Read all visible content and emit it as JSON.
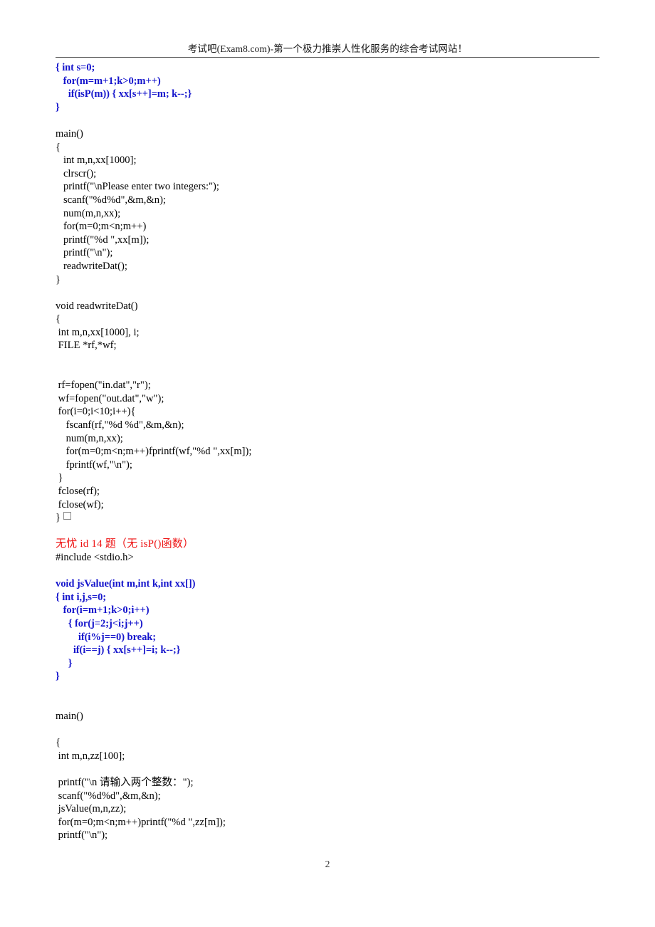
{
  "document": {
    "page_number": "2",
    "header_text": "考试吧(Exam8.com)-第一个极力推崇人性化服务的综合考试网站！",
    "colors": {
      "code_blue": "#1515CC",
      "heading_red": "#EE1111",
      "body_black": "#000000",
      "rule_gray": "#555555"
    }
  },
  "lines": [
    {
      "id": "l001",
      "style": "blue",
      "text": "{ int s=0;"
    },
    {
      "id": "l002",
      "style": "blue",
      "text": "   for(m=m+1;k>0;m++)"
    },
    {
      "id": "l003",
      "style": "blue",
      "text": "     if(isP(m)) { xx[s++]=m; k--;}"
    },
    {
      "id": "l004",
      "style": "blue",
      "text": "}"
    },
    {
      "id": "l005",
      "style": "blank",
      "text": " "
    },
    {
      "id": "l006",
      "style": "plain",
      "text": "main()"
    },
    {
      "id": "l007",
      "style": "plain",
      "text": "{"
    },
    {
      "id": "l008",
      "style": "plain",
      "text": "   int m,n,xx[1000];"
    },
    {
      "id": "l009",
      "style": "plain",
      "text": "   clrscr();"
    },
    {
      "id": "l010",
      "style": "plain",
      "text": "   printf(\"\\nPlease enter two integers:\");"
    },
    {
      "id": "l011",
      "style": "plain",
      "text": "   scanf(\"%d%d\",&m,&n);"
    },
    {
      "id": "l012",
      "style": "plain",
      "text": "   num(m,n,xx);"
    },
    {
      "id": "l013",
      "style": "plain",
      "text": "   for(m=0;m<n;m++)"
    },
    {
      "id": "l014",
      "style": "plain",
      "text": "   printf(\"%d \",xx[m]);"
    },
    {
      "id": "l015",
      "style": "plain",
      "text": "   printf(\"\\n\");"
    },
    {
      "id": "l016",
      "style": "plain",
      "text": "   readwriteDat();"
    },
    {
      "id": "l017",
      "style": "plain",
      "text": "}"
    },
    {
      "id": "l018",
      "style": "blank",
      "text": " "
    },
    {
      "id": "l019",
      "style": "plain",
      "text": "void readwriteDat()"
    },
    {
      "id": "l020",
      "style": "plain",
      "text": "{"
    },
    {
      "id": "l021",
      "style": "plain",
      "text": " int m,n,xx[1000], i;"
    },
    {
      "id": "l022",
      "style": "plain",
      "text": " FILE *rf,*wf;"
    },
    {
      "id": "l023",
      "style": "blank",
      "text": " "
    },
    {
      "id": "l024",
      "style": "blank",
      "text": " "
    },
    {
      "id": "l025",
      "style": "plain",
      "text": " rf=fopen(\"in.dat\",\"r\");"
    },
    {
      "id": "l026",
      "style": "plain",
      "text": " wf=fopen(\"out.dat\",\"w\");"
    },
    {
      "id": "l027",
      "style": "plain",
      "text": " for(i=0;i<10;i++){"
    },
    {
      "id": "l028",
      "style": "plain",
      "text": "    fscanf(rf,\"%d %d\",&m,&n);"
    },
    {
      "id": "l029",
      "style": "plain",
      "text": "    num(m,n,xx);"
    },
    {
      "id": "l030",
      "style": "plain",
      "text": "    for(m=0;m<n;m++)fprintf(wf,\"%d \",xx[m]);"
    },
    {
      "id": "l031",
      "style": "plain",
      "text": "    fprintf(wf,\"\\n\");"
    },
    {
      "id": "l032",
      "style": "plain",
      "text": " }"
    },
    {
      "id": "l033",
      "style": "plain",
      "text": " fclose(rf);"
    },
    {
      "id": "l034",
      "style": "plain",
      "text": " fclose(wf);"
    },
    {
      "id": "l035",
      "style": "box",
      "text": "}"
    },
    {
      "id": "l036",
      "style": "blank",
      "text": " "
    },
    {
      "id": "l037",
      "style": "red",
      "text": "无忧 id 14 题（无 isP()函数）"
    },
    {
      "id": "l038",
      "style": "plain",
      "text": "#include <stdio.h>"
    },
    {
      "id": "l039",
      "style": "blank",
      "text": " "
    },
    {
      "id": "l040",
      "style": "blue",
      "text": "void jsValue(int m,int k,int xx[])"
    },
    {
      "id": "l041",
      "style": "blue",
      "text": "{ int i,j,s=0;"
    },
    {
      "id": "l042",
      "style": "blue",
      "text": "   for(i=m+1;k>0;i++)"
    },
    {
      "id": "l043",
      "style": "blue",
      "text": "     { for(j=2;j<i;j++)"
    },
    {
      "id": "l044",
      "style": "blue",
      "text": "         if(i%j==0) break;"
    },
    {
      "id": "l045",
      "style": "blue",
      "text": "       if(i==j) { xx[s++]=i; k--;}"
    },
    {
      "id": "l046",
      "style": "blue",
      "text": "     }"
    },
    {
      "id": "l047",
      "style": "blue",
      "text": "}"
    },
    {
      "id": "l048",
      "style": "blank",
      "text": " "
    },
    {
      "id": "l049",
      "style": "blank",
      "text": " "
    },
    {
      "id": "l050",
      "style": "plain",
      "text": "main()"
    },
    {
      "id": "l051",
      "style": "blank",
      "text": " "
    },
    {
      "id": "l052",
      "style": "plain",
      "text": "{"
    },
    {
      "id": "l053",
      "style": "plain",
      "text": " int m,n,zz[100];"
    },
    {
      "id": "l054",
      "style": "blank",
      "text": " "
    },
    {
      "id": "l055",
      "style": "plain",
      "text": " printf(\"\\n 请输入两个整数：\");"
    },
    {
      "id": "l056",
      "style": "plain",
      "text": " scanf(\"%d%d\",&m,&n);"
    },
    {
      "id": "l057",
      "style": "plain",
      "text": " jsValue(m,n,zz);"
    },
    {
      "id": "l058",
      "style": "plain",
      "text": " for(m=0;m<n;m++)printf(\"%d \",zz[m]);"
    },
    {
      "id": "l059",
      "style": "plain",
      "text": " printf(\"\\n\");"
    }
  ]
}
